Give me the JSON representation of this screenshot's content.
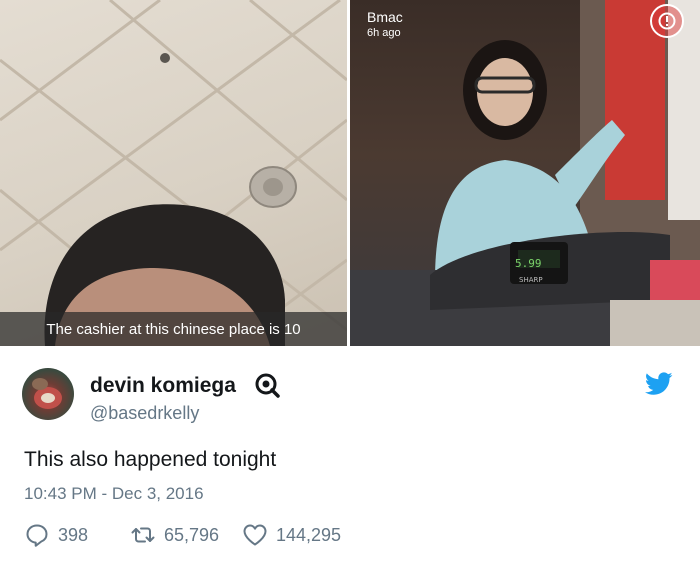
{
  "photo_left": {
    "caption": "The cashier at this chinese place is 10"
  },
  "photo_right": {
    "snap_user": "Bmac",
    "snap_time": "6h ago",
    "register_display": "5.99",
    "register_brand": "SHARP"
  },
  "tweet": {
    "display_name": "devin komiega",
    "handle": "@basedrkelly",
    "text": "This also happened tonight",
    "timestamp": "10:43 PM - Dec 3, 2016",
    "reply_count": "398",
    "retweet_count": "65,796",
    "like_count": "144,295"
  },
  "icons": {
    "verified": "verified-badge-icon",
    "bird": "twitter-bird-icon",
    "reply": "reply-icon",
    "retweet": "retweet-icon",
    "like": "heart-icon"
  },
  "colors": {
    "twitter_blue": "#1da1f2",
    "secondary_text": "#657786",
    "primary_text": "#14171a"
  }
}
